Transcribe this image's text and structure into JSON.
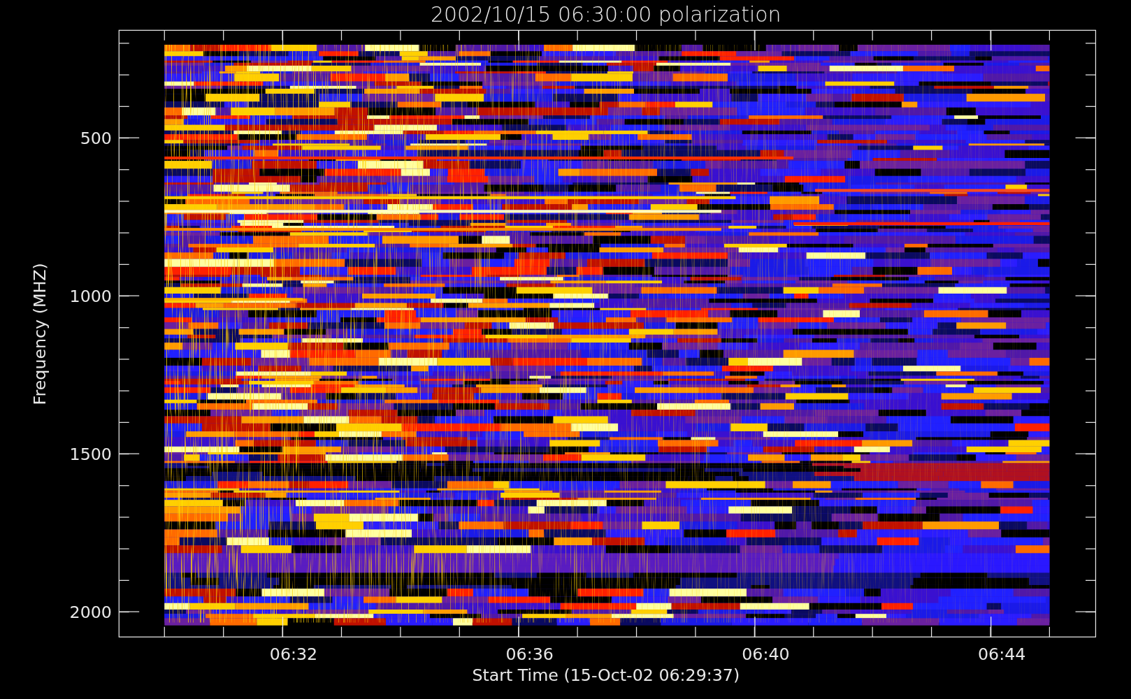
{
  "title": "2002/10/15 06:30:00 polarization",
  "y_axis": {
    "label": "Frequency (MHZ)",
    "tick_labels": [
      "500",
      "1000",
      "1500",
      "2000"
    ]
  },
  "x_axis": {
    "label": "Start Time (15-Oct-02 06:29:37)",
    "tick_labels": [
      "06:32",
      "06:36",
      "06:40",
      "06:44"
    ]
  }
}
